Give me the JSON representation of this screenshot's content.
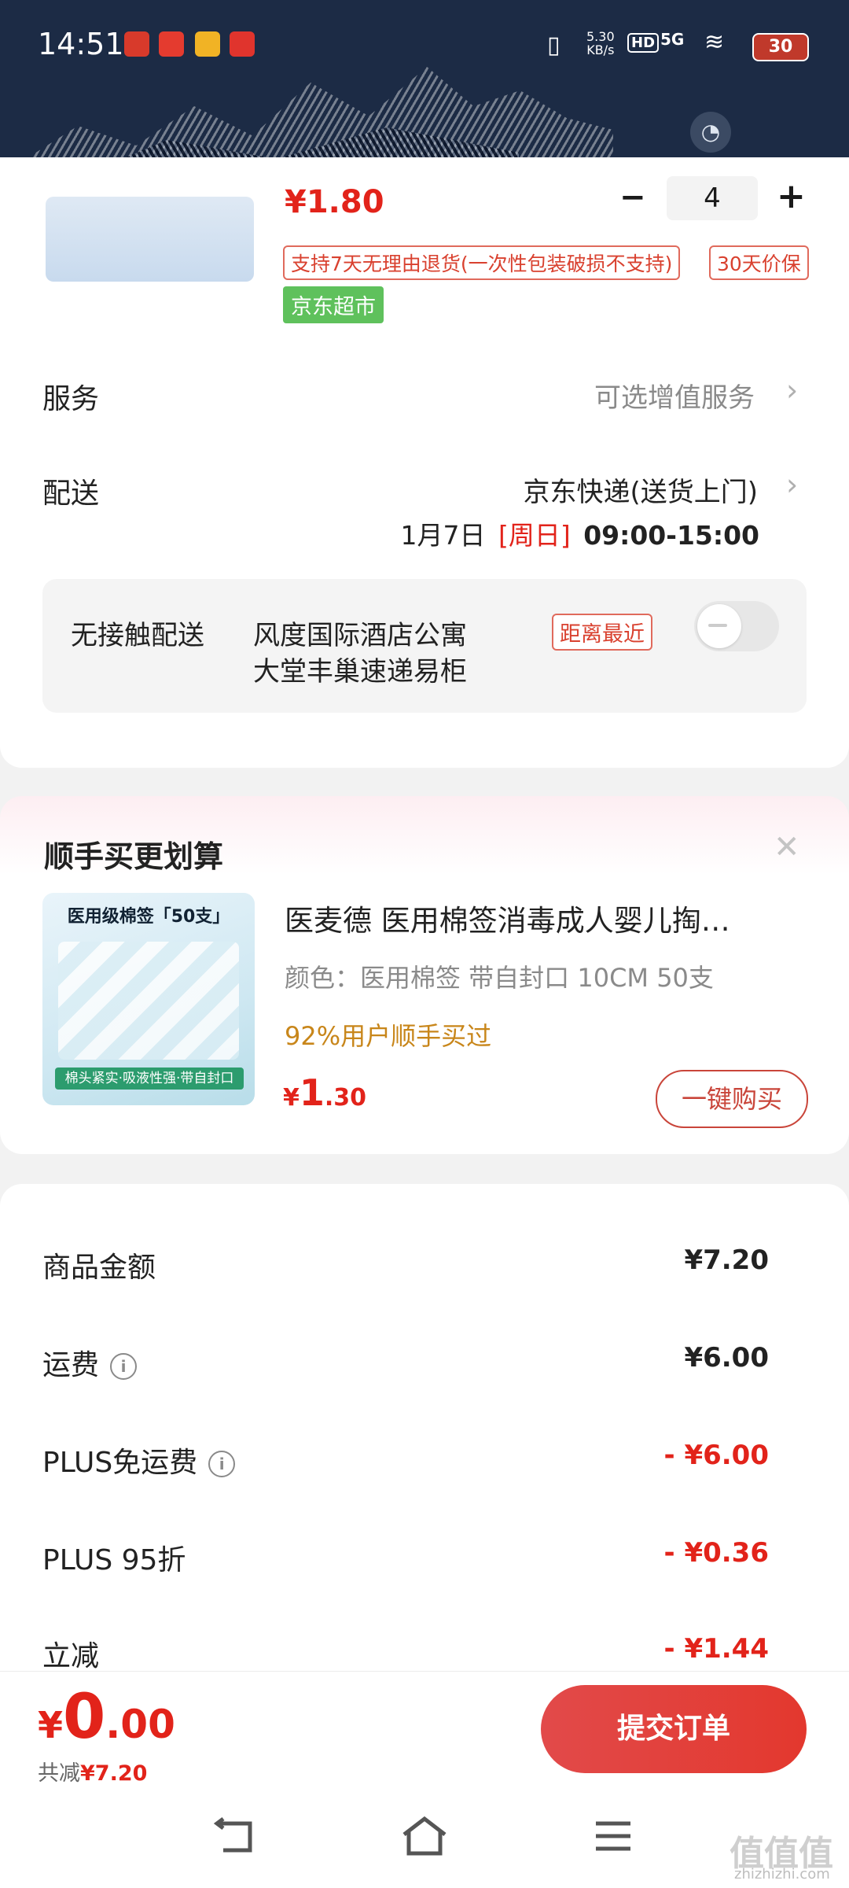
{
  "status_bar": {
    "time": "14:51",
    "network_speed_top": "5.30",
    "network_speed_bottom": "KB/s",
    "hd": "HD",
    "signal": "5G",
    "battery": "30"
  },
  "product": {
    "price_partial": "¥1.80",
    "qty_minus": "−",
    "quantity": "4",
    "qty_plus": "+",
    "return_tag": "支持7天无理由退货(一次性包装破损不支持)",
    "price_protect_tag": "30天价保",
    "store_tag": "京东超市"
  },
  "service": {
    "label": "服务",
    "value": "可选增值服务"
  },
  "delivery": {
    "label": "配送",
    "method": "京东快递(送货上门)",
    "date": "1月7日",
    "weekday": "[周日]",
    "time_window": "09:00-15:00"
  },
  "contactless": {
    "label": "无接触配送",
    "address_line1": "风度国际酒店公寓",
    "address_line2": "大堂丰巢速递易柜",
    "badge": "距离最近"
  },
  "cross_sell": {
    "title": "顺手买更划算",
    "close": "✕",
    "thumb_banner": "医用级棉签「50支」",
    "thumb_strip": "棉头紧实·吸液性强·带自封口",
    "name": "医麦德 医用棉签消毒成人婴儿掏…",
    "spec": "颜色：医用棉签 带自封口 10CM 50支",
    "social": "92%用户顺手买过",
    "price_symbol": "¥",
    "price_int": "1",
    "price_dec": ".30",
    "buy_label": "一键购买"
  },
  "summary": {
    "rows": [
      {
        "label": "商品金额",
        "value": "¥7.20"
      },
      {
        "label": "运费",
        "value": "¥6.00"
      },
      {
        "label": "PLUS免运费",
        "value": "- ¥6.00"
      },
      {
        "label": "PLUS 95折",
        "value": "- ¥0.36"
      },
      {
        "label": "立减",
        "value": "- ¥1.44"
      }
    ]
  },
  "bottom": {
    "total_symbol": "¥",
    "total_int": "0",
    "total_dec": ".00",
    "saved_label": "共减",
    "saved_value": "¥7.20",
    "submit_label": "提交订单"
  },
  "watermark": {
    "text1": "值值值",
    "text2": "zhizhizhi.com"
  },
  "colors": {
    "header_bg": "#1c2b45",
    "accent_red": "#e2231a",
    "tag_green": "#5fc15c",
    "orange_text": "#c8861a"
  },
  "icons": [
    "info-icon",
    "chevron-right-icon",
    "close-icon",
    "back-nav-icon",
    "home-nav-icon",
    "menu-nav-icon",
    "vibrate-icon",
    "wifi-icon",
    "battery-icon",
    "face-icon"
  ]
}
